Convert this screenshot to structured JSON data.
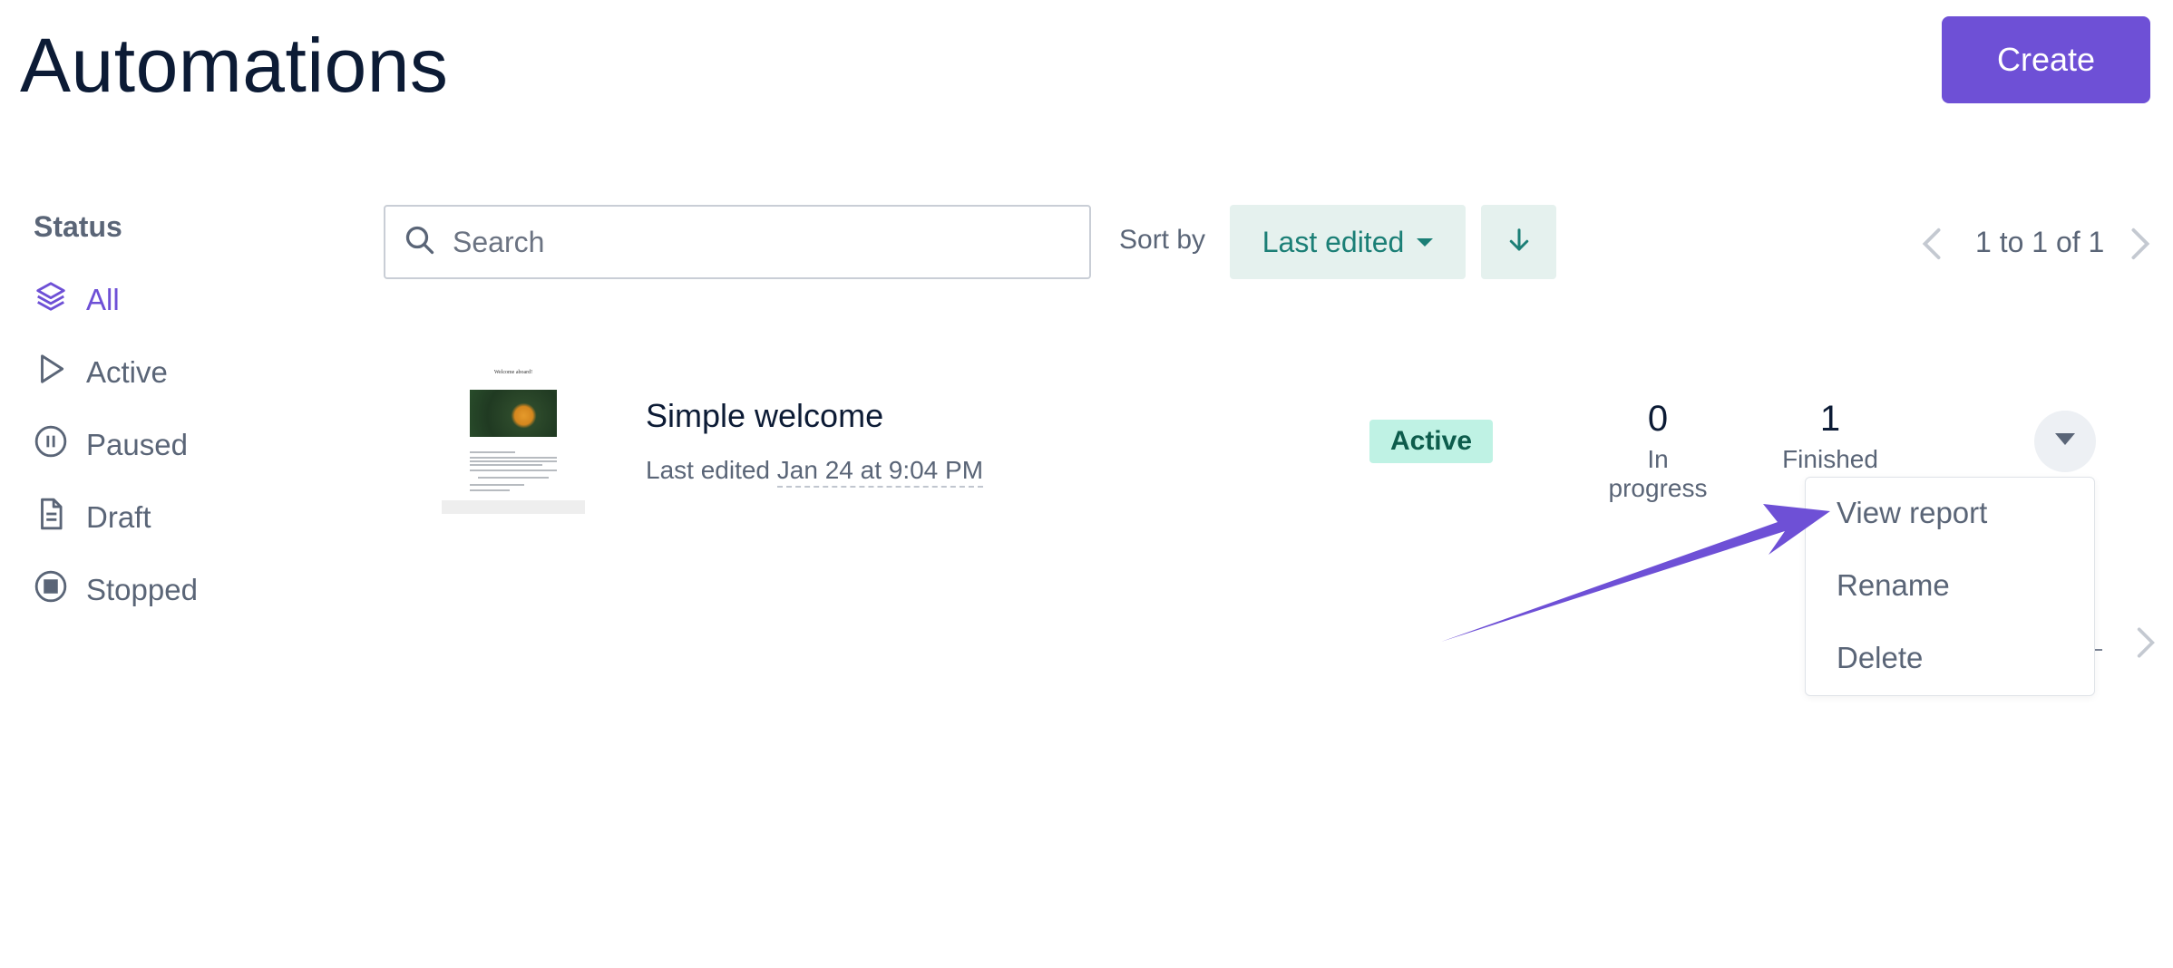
{
  "header": {
    "title": "Automations",
    "create_label": "Create"
  },
  "sidebar": {
    "heading": "Status",
    "items": [
      {
        "label": "All",
        "icon": "layers-icon",
        "selected": true
      },
      {
        "label": "Active",
        "icon": "play-icon"
      },
      {
        "label": "Paused",
        "icon": "pause-circle-icon"
      },
      {
        "label": "Draft",
        "icon": "document-icon"
      },
      {
        "label": "Stopped",
        "icon": "stop-circle-icon"
      }
    ]
  },
  "toolbar": {
    "search_placeholder": "Search",
    "sort_label": "Sort by",
    "sort_value": "Last edited",
    "sort_direction": "descending"
  },
  "pagination": {
    "text": "1 to 1 of 1"
  },
  "automations": [
    {
      "name": "Simple welcome",
      "edited_prefix": "Last edited ",
      "edited_date": "Jan 24 at 9:04 PM",
      "status": "Active",
      "in_progress": "0",
      "in_progress_label": "In progress",
      "finished": "1",
      "finished_label": "Finished",
      "thumbnail_title": "Welcome aboard!"
    }
  ],
  "row_menu": {
    "items": [
      "View report",
      "Rename",
      "Delete"
    ]
  },
  "colors": {
    "accent": "#6e50d6",
    "teal": "#1b7f76",
    "badge_bg": "#bff2e4",
    "text_muted": "#5a6577"
  }
}
